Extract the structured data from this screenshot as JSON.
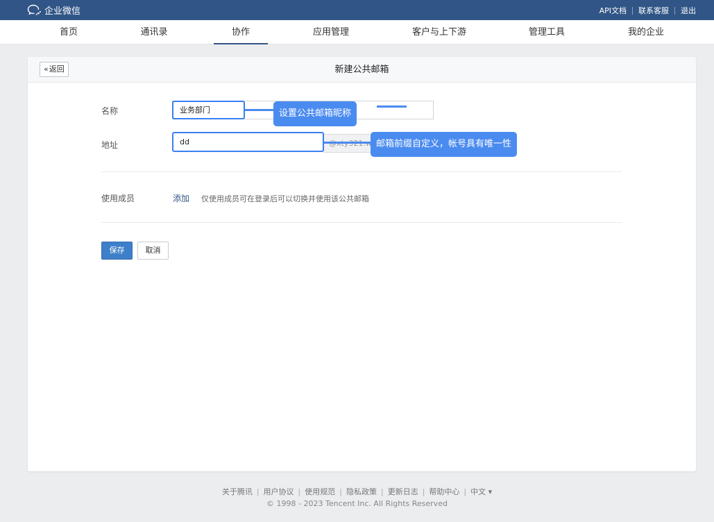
{
  "topbar": {
    "brand": "企业微信",
    "links": [
      "API文档",
      "联系客服",
      "退出"
    ]
  },
  "nav": {
    "items": [
      "首页",
      "通讯录",
      "协作",
      "应用管理",
      "客户与上下游",
      "管理工具",
      "我的企业"
    ],
    "active": "协作"
  },
  "panel": {
    "back_label": "返回",
    "title": "新建公共邮箱"
  },
  "form": {
    "name_label": "名称",
    "name_value": "业务部门",
    "address_label": "地址",
    "address_value": "dd",
    "domain_suffix": "@xty321.w",
    "members_label": "使用成员",
    "add_link": "添加",
    "members_hint": "仅使用成员可在登录后可以切换并使用该公共邮箱",
    "save_label": "保存",
    "cancel_label": "取消"
  },
  "tooltips": {
    "name_tip": "设置公共邮箱昵称",
    "address_tip": "邮箱前缀自定义，帐号具有唯一性"
  },
  "footer": {
    "links": [
      "关于腾讯",
      "用户协议",
      "使用规范",
      "隐私政策",
      "更新日志",
      "帮助中心",
      "中文 ▾"
    ],
    "copyright": "© 1998 - 2023 Tencent Inc. All Rights Reserved"
  },
  "colors": {
    "topbar": "#305586",
    "accent": "#3a7ff3",
    "tooltip": "#4a8bf0",
    "save_button": "#3d7fc9"
  }
}
